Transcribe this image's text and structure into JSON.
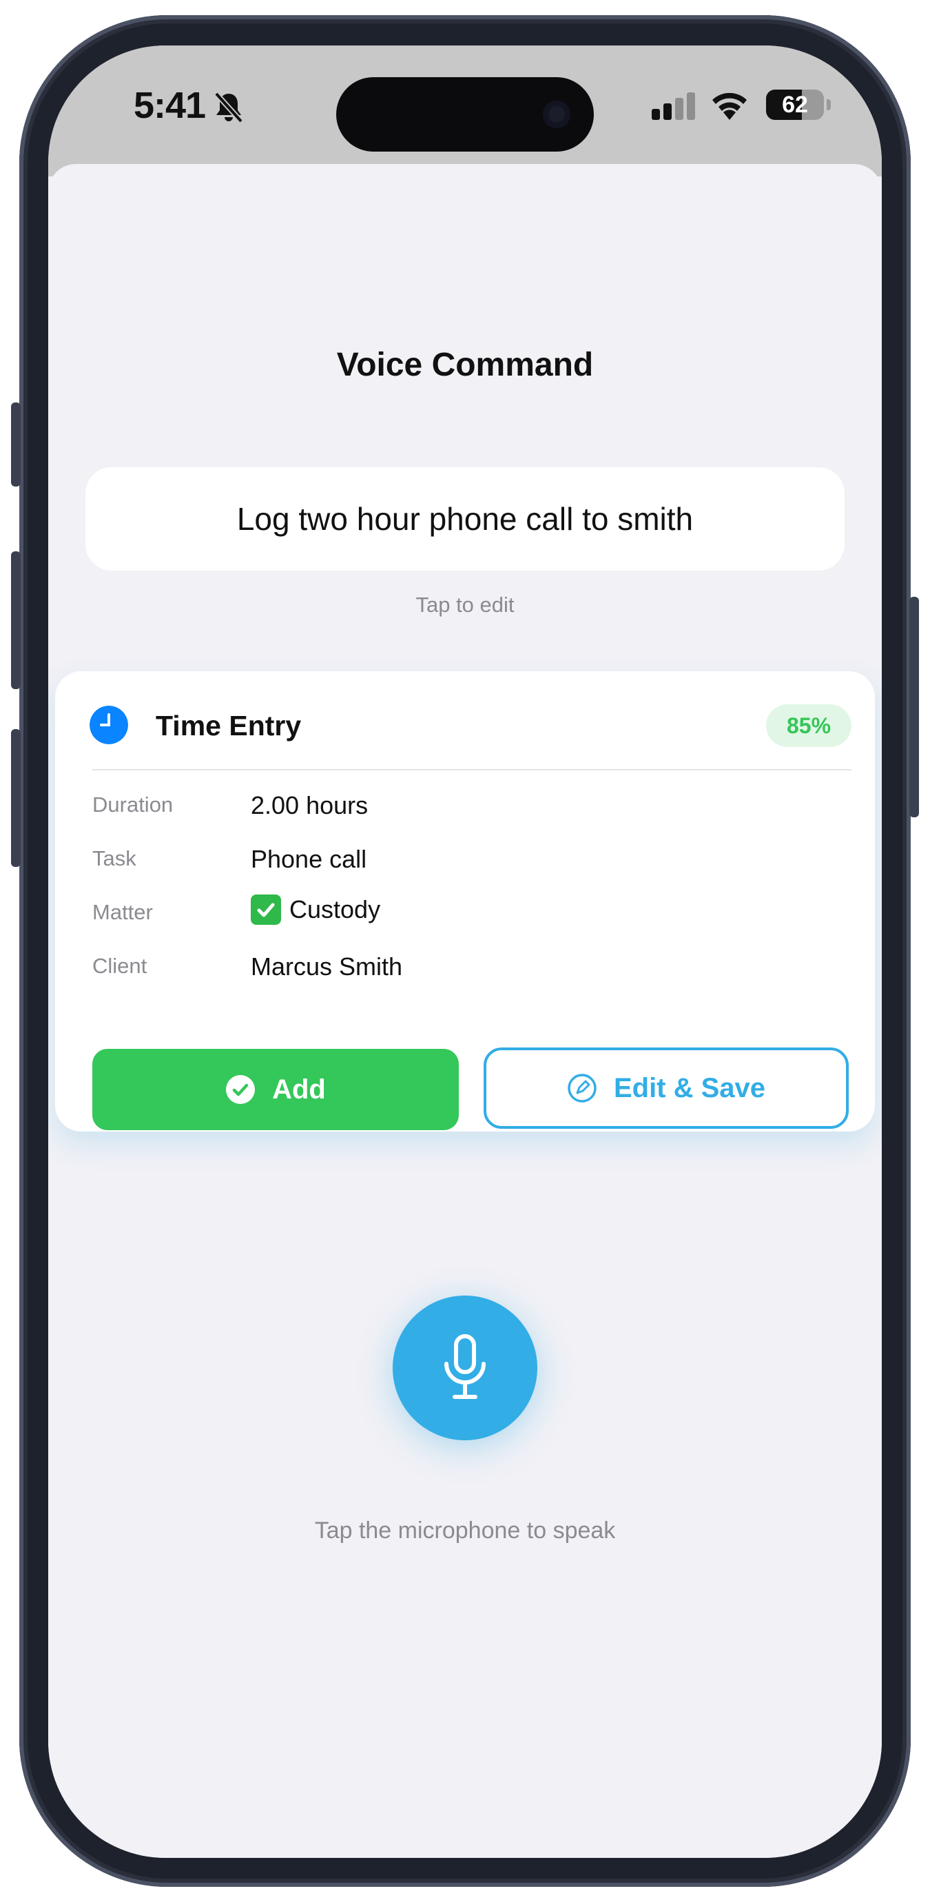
{
  "status_bar": {
    "time": "5:41",
    "battery": "62",
    "battery_level": 0.62
  },
  "header": {
    "title": "Voice Command"
  },
  "command": {
    "text": "Log two hour phone call to smith",
    "hint": "Tap to edit"
  },
  "entry_card": {
    "title": "Time Entry",
    "confidence": "85%",
    "fields": [
      {
        "label": "Duration",
        "value": "2.00 hours"
      },
      {
        "label": "Task",
        "value": "Phone call"
      },
      {
        "label": "Matter",
        "value": "Custody",
        "emoji": "check-mark-button"
      },
      {
        "label": "Client",
        "value": "Marcus Smith"
      }
    ],
    "add_label": "Add",
    "edit_label": "Edit & Save"
  },
  "microphone": {
    "hint": "Tap the microphone to speak"
  },
  "colors": {
    "accent_blue": "#32ade6",
    "success_green": "#34c759",
    "icon_blue": "#0a84ff",
    "background": "#f1f1f6"
  }
}
